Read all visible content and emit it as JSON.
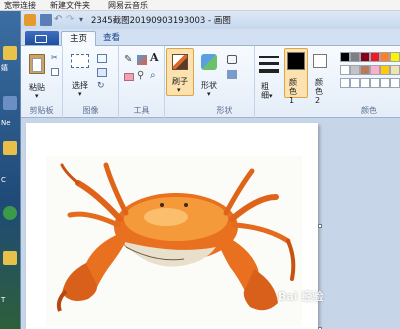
{
  "desktop": {
    "taskbar_items": [
      "宽带连接",
      "新建文件夹",
      "网易云音乐"
    ],
    "left_labels": [
      "嬉",
      "Ne",
      "1",
      "C",
      "T"
    ]
  },
  "window": {
    "title": "2345截图20190903193003 - 画图"
  },
  "tabs": [
    "主页",
    "查看"
  ],
  "ribbon": {
    "clipboard": {
      "paste_label": "粘贴",
      "group_label": "剪贴板"
    },
    "image": {
      "select_label": "选择",
      "group_label": "图像"
    },
    "tools": {
      "group_label": "工具"
    },
    "brushes": {
      "label": "刷子"
    },
    "shapes": {
      "label": "形状",
      "group_label": "形状"
    },
    "size": {
      "label": "粗细"
    },
    "color1": {
      "label": "颜色 1"
    },
    "color2": {
      "label": "颜色 2"
    },
    "colors": {
      "group_label": "颜色"
    }
  },
  "palette": [
    "#000000",
    "#7f7f7f",
    "#880015",
    "#ed1c24",
    "#ff7f27",
    "#fff200",
    "#ffffff",
    "#c3c3c3",
    "#b97a57",
    "#ffaec9",
    "#ffc90e",
    "#efe4b0",
    "#ffffff",
    "#ffffff",
    "#ffffff",
    "#ffffff",
    "#ffffff",
    "#ffffff"
  ],
  "watermark": "Bai 经验"
}
